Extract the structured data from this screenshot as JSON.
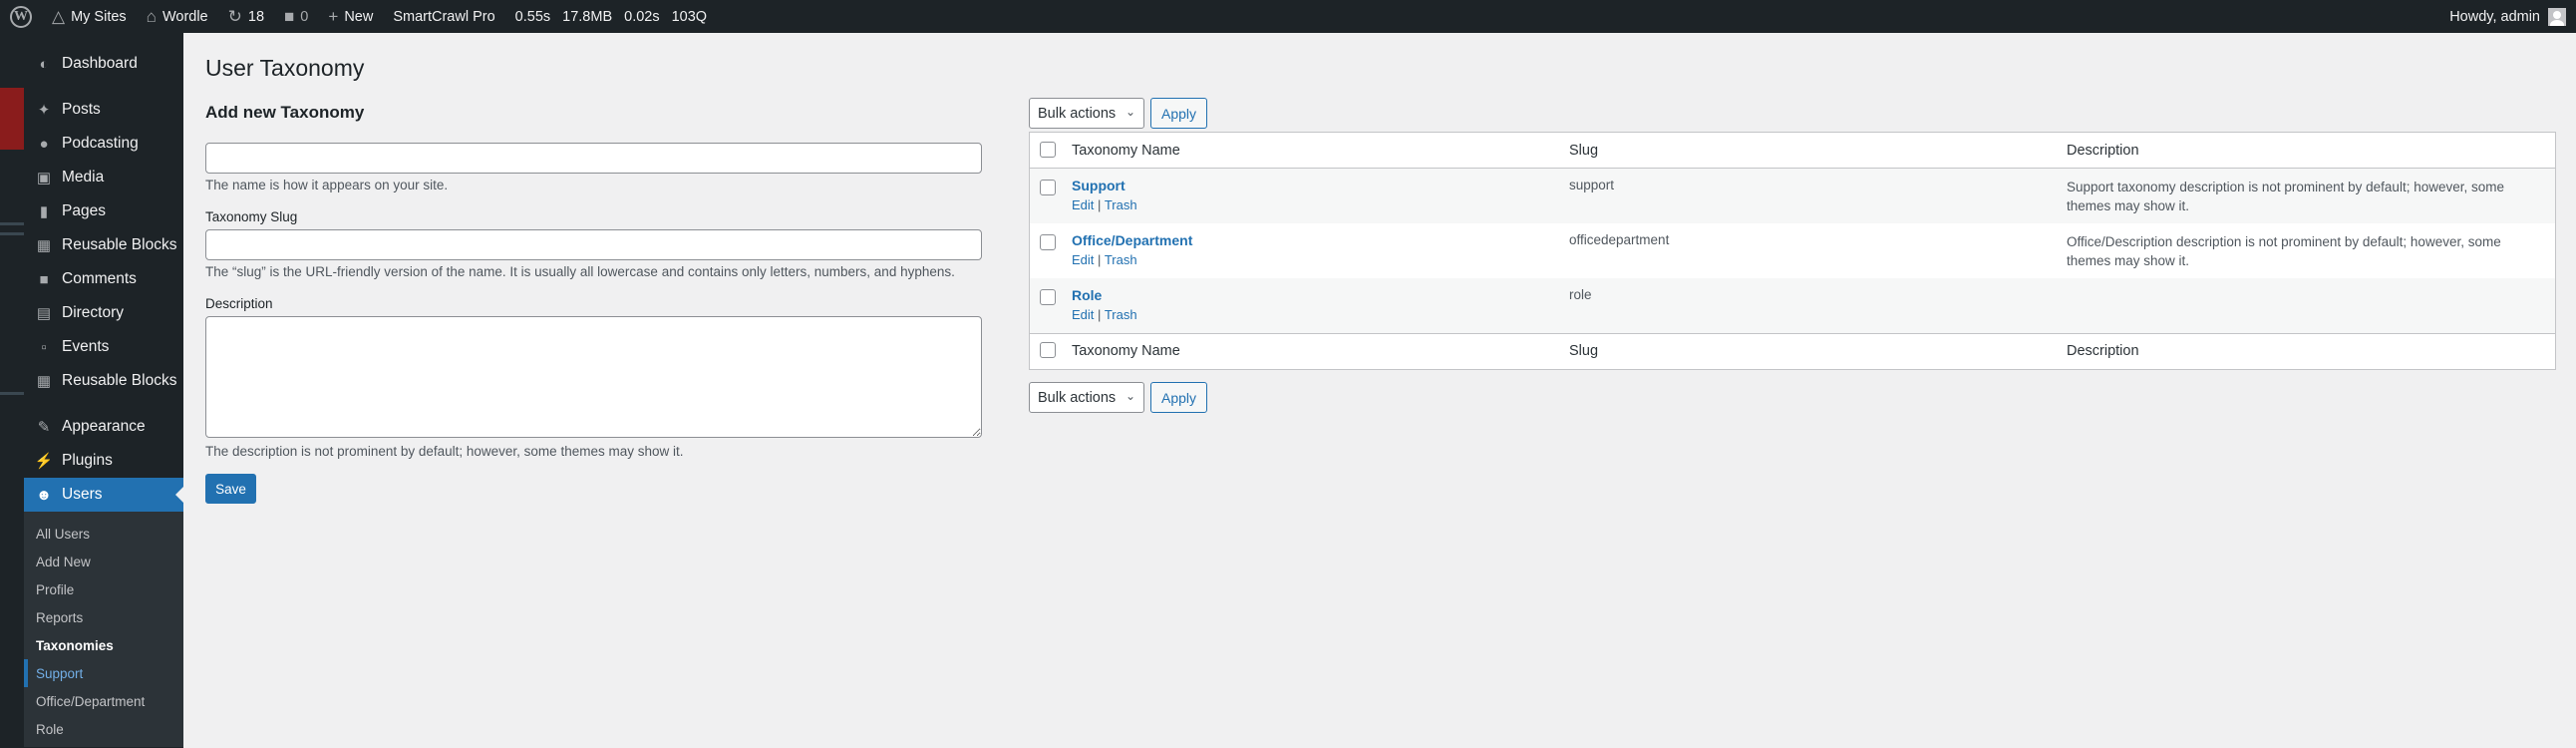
{
  "admin_bar": {
    "my_sites": "My Sites",
    "site_name": "Wordle",
    "updates_count": "18",
    "comments_count": "0",
    "new_label": "New",
    "plugin_label": "SmartCrawl Pro",
    "stat_time": "0.55s",
    "stat_memory": "17.8MB",
    "stat_query_time": "0.02s",
    "stat_queries": "103Q",
    "greeting": "Howdy, admin"
  },
  "sidebar": {
    "items": [
      {
        "label": "Dashboard",
        "icon": "dashboard-icon"
      },
      {
        "label": "Posts",
        "icon": "pin-icon"
      },
      {
        "label": "Podcasting",
        "icon": "microphone-icon"
      },
      {
        "label": "Media",
        "icon": "media-icon"
      },
      {
        "label": "Pages",
        "icon": "page-icon"
      },
      {
        "label": "Reusable Blocks",
        "icon": "block-icon"
      },
      {
        "label": "Comments",
        "icon": "comment-icon"
      },
      {
        "label": "Directory",
        "icon": "folder-icon"
      },
      {
        "label": "Events",
        "icon": "calendar-icon"
      },
      {
        "label": "Reusable Blocks",
        "icon": "block-icon"
      },
      {
        "label": "Appearance",
        "icon": "brush-icon"
      },
      {
        "label": "Plugins",
        "icon": "plug-icon"
      },
      {
        "label": "Users",
        "icon": "user-icon"
      }
    ],
    "submenu": [
      {
        "label": "All Users"
      },
      {
        "label": "Add New"
      },
      {
        "label": "Profile"
      },
      {
        "label": "Reports"
      },
      {
        "label": "Taxonomies"
      },
      {
        "label": "Support"
      },
      {
        "label": "Office/Department"
      },
      {
        "label": "Role"
      }
    ]
  },
  "page": {
    "title": "User Taxonomy"
  },
  "form": {
    "title": "Add new Taxonomy",
    "name_value": "",
    "name_help": "The name is how it appears on your site.",
    "slug_label": "Taxonomy Slug",
    "slug_value": "",
    "slug_help": "The “slug” is the URL-friendly version of the name. It is usually all lowercase and contains only letters, numbers, and hyphens.",
    "description_label": "Description",
    "description_value": "",
    "description_help": "The description is not prominent by default; however, some themes may show it.",
    "save_label": "Save"
  },
  "table": {
    "bulk_actions": "Bulk actions",
    "apply_label": "Apply",
    "columns": {
      "name": "Taxonomy Name",
      "slug": "Slug",
      "description": "Description"
    },
    "row_actions": {
      "edit": "Edit",
      "separator": "|",
      "trash": "Trash"
    },
    "rows": [
      {
        "name": "Support",
        "slug": "support",
        "description": "Support taxonomy description is not prominent by default; however, some themes may show it."
      },
      {
        "name": "Office/Department",
        "slug": "officedepartment",
        "description": "Office/Description description is not prominent by default; however, some themes may show it."
      },
      {
        "name": "Role",
        "slug": "role",
        "description": ""
      }
    ]
  },
  "colors": {
    "admin_bar_bg": "#1d2327",
    "accent": "#2271b1",
    "page_bg": "#f0f0f1"
  }
}
